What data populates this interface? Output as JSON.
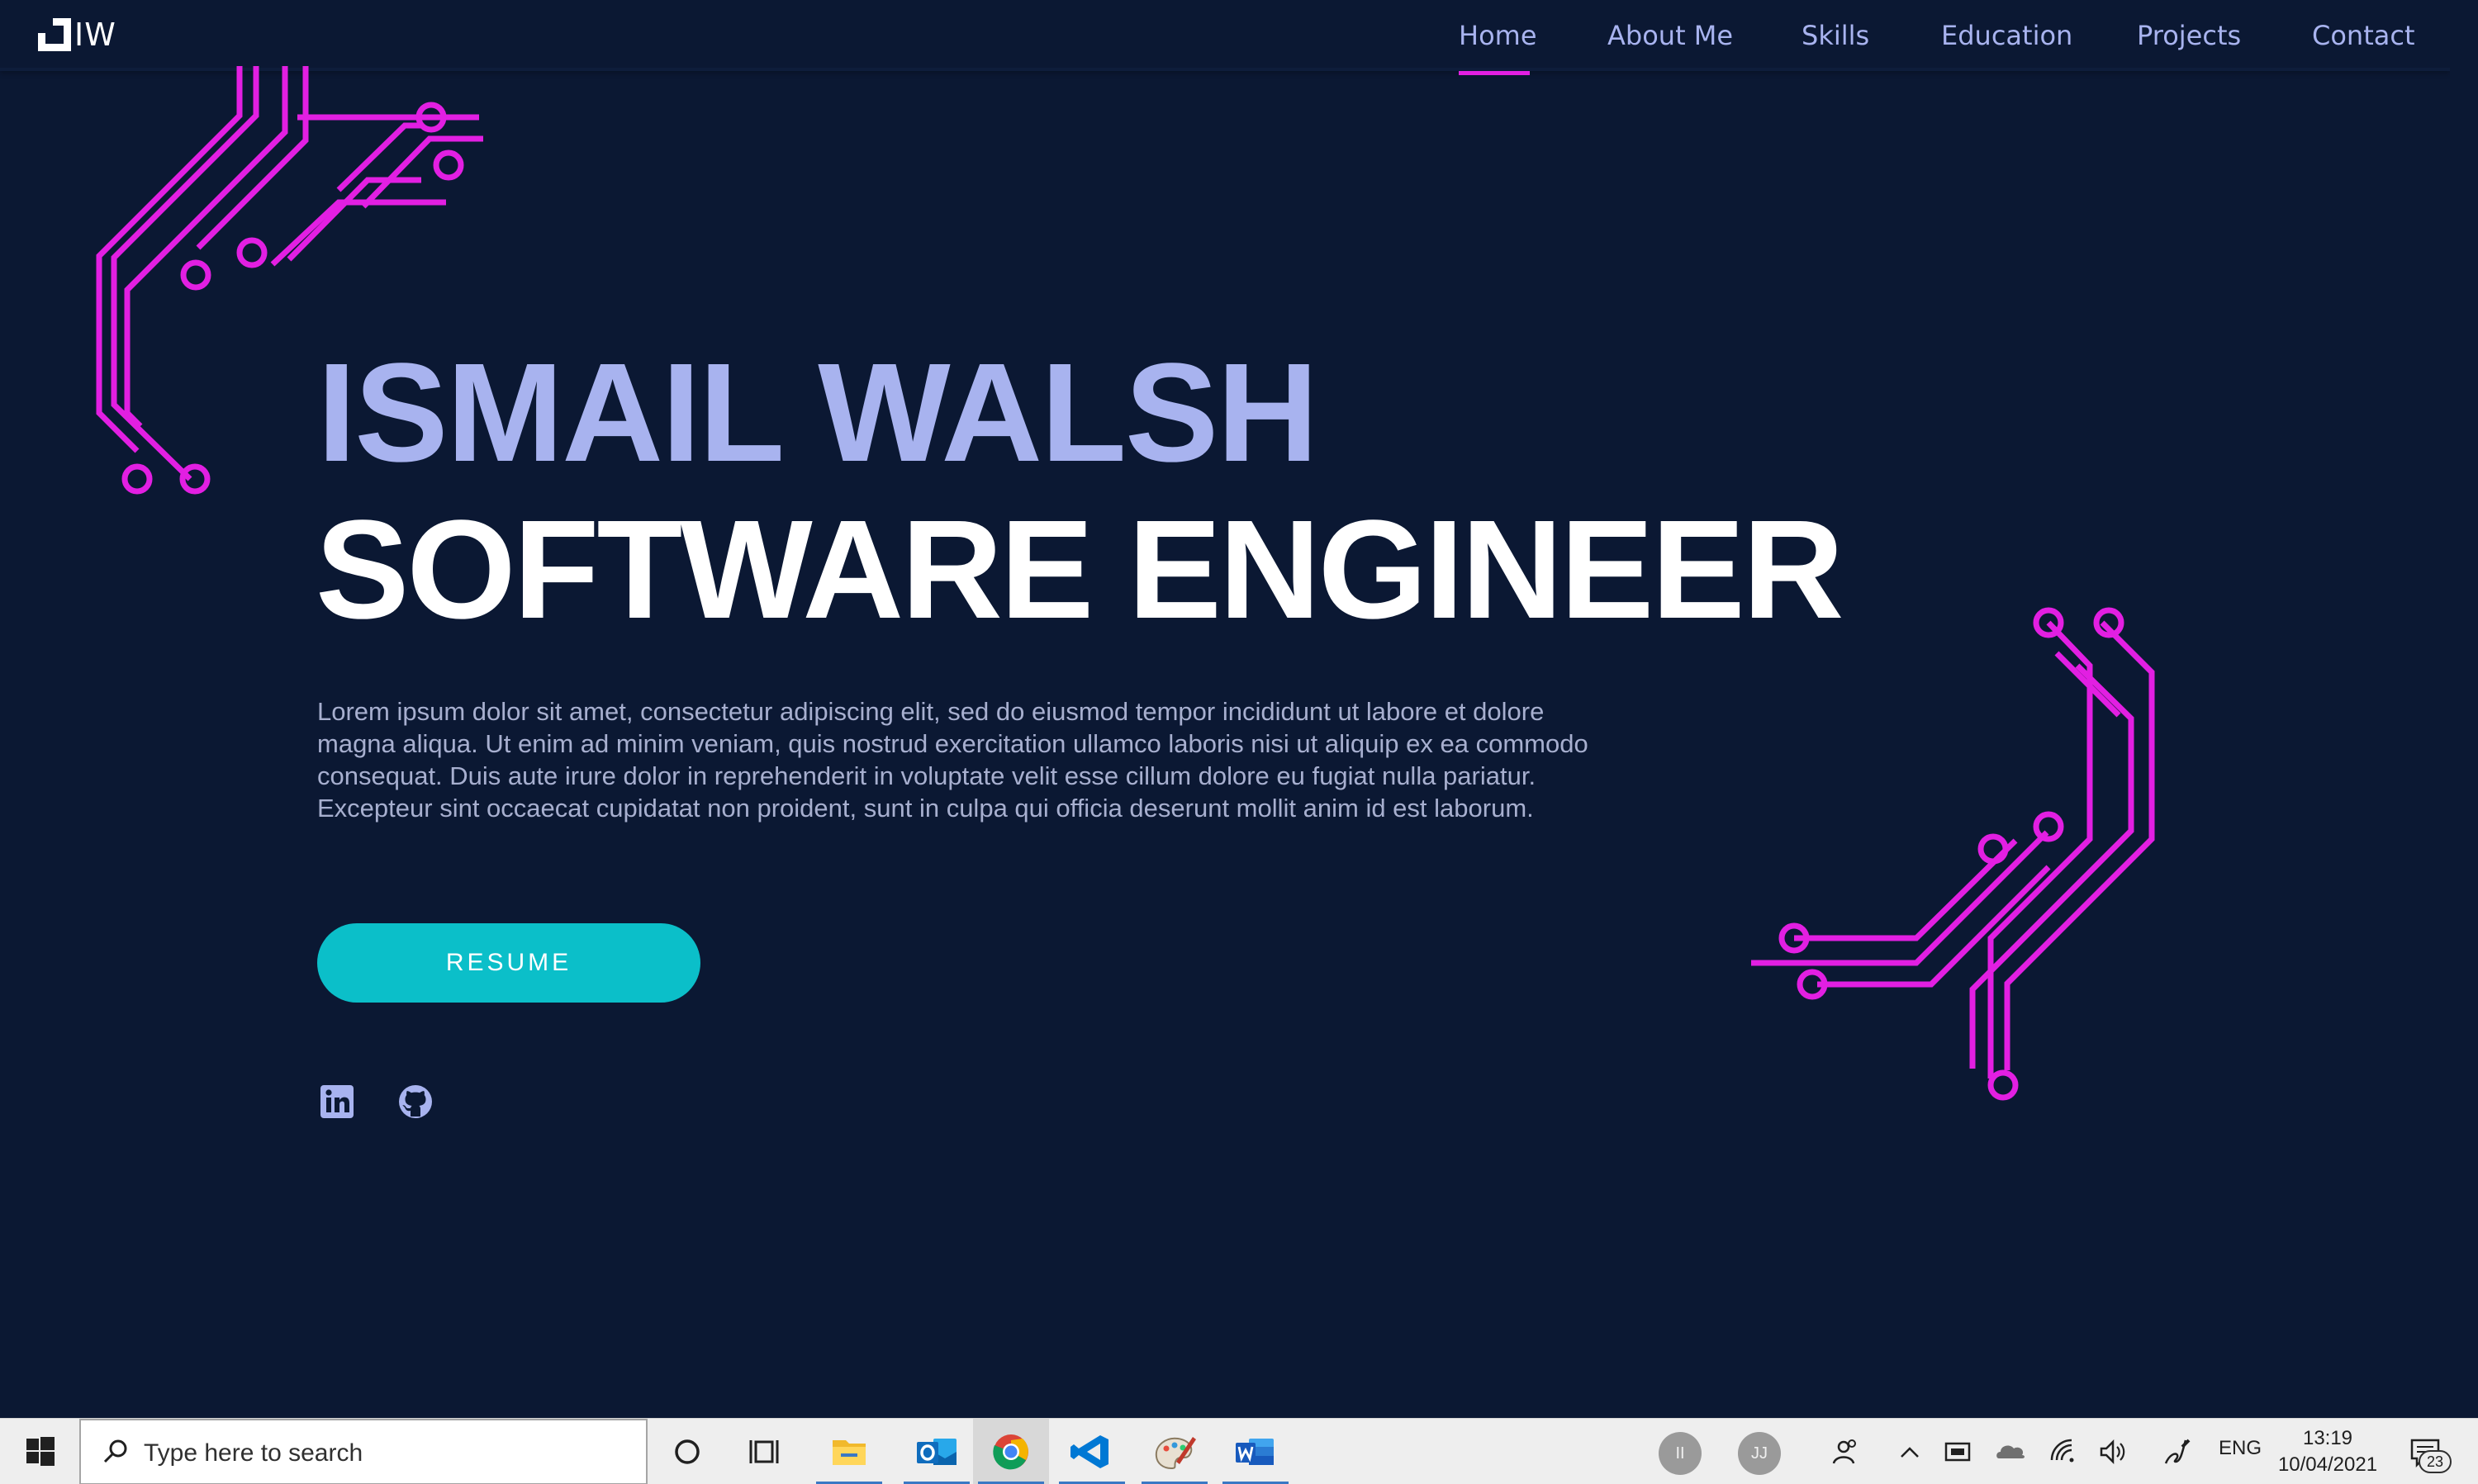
{
  "site": {
    "logo_text": "IW",
    "nav": [
      {
        "label": "Home",
        "active": true
      },
      {
        "label": "About Me",
        "active": false
      },
      {
        "label": "Skills",
        "active": false
      },
      {
        "label": "Education",
        "active": false
      },
      {
        "label": "Projects",
        "active": false
      },
      {
        "label": "Contact",
        "active": false
      }
    ],
    "hero": {
      "name": "ISMAIL WALSH",
      "title": "SOFTWARE ENGINEER",
      "text": "Lorem ipsum dolor sit amet, consectetur adipiscing elit, sed do eiusmod tempor incididunt ut labore et dolore magna aliqua. Ut enim ad minim veniam, quis nostrud exercitation ullamco laboris nisi ut aliquip ex ea commodo consequat. Duis aute irure dolor in reprehenderit in voluptate velit esse cillum dolore eu fugiat nulla pariatur. Excepteur sint occaecat cupidatat non proident, sunt in culpa qui officia deserunt mollit anim id est laborum.",
      "resume_label": "RESUME",
      "socials": [
        "linkedin-icon",
        "github-icon"
      ]
    },
    "colors": {
      "background": "#0b1833",
      "accent_magenta": "#e21fe2",
      "accent_cyan": "#0bbfc9",
      "name_color": "#a8b3ef"
    }
  },
  "taskbar": {
    "search_placeholder": "Type here to search",
    "apps": [
      "file-explorer-icon",
      "outlook-icon",
      "chrome-icon",
      "vscode-icon",
      "paint-icon",
      "word-icon"
    ],
    "avatars": [
      "II",
      "JJ"
    ],
    "language": "ENG",
    "time": "13:19",
    "date": "10/04/2021",
    "notification_count": "23"
  }
}
